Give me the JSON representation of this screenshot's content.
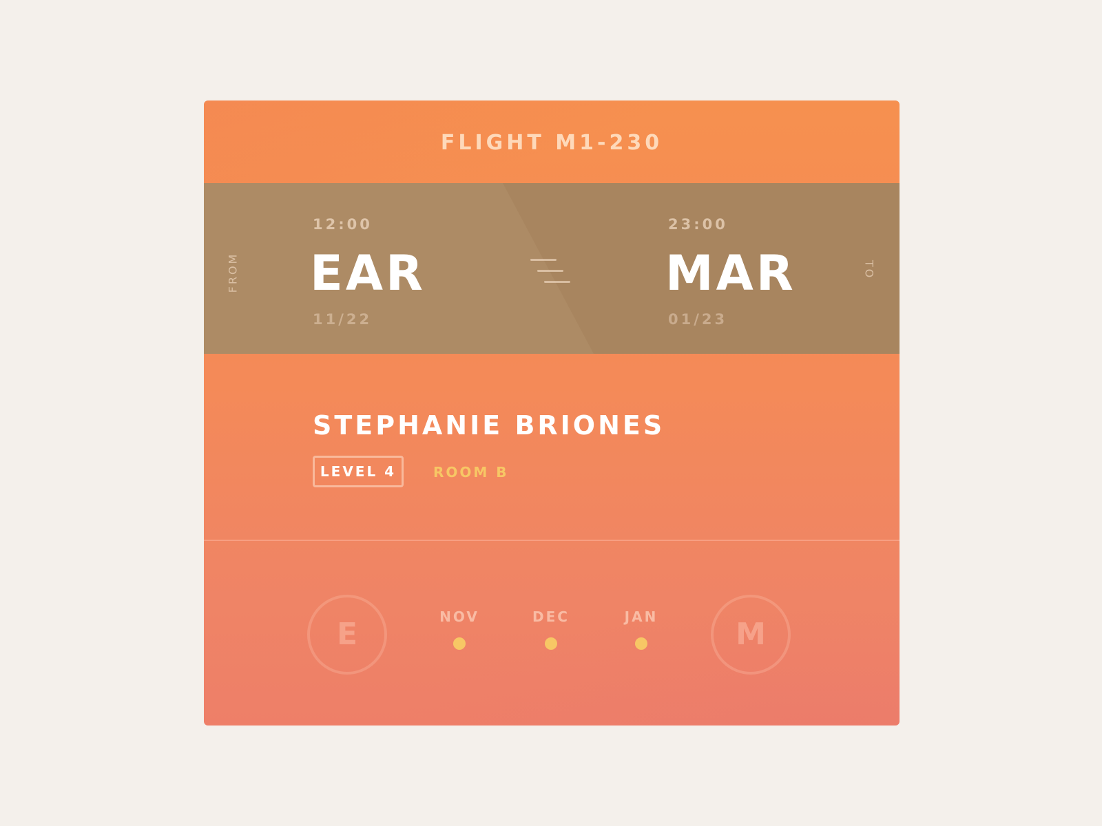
{
  "flight": {
    "title": "FLIGHT M1-230"
  },
  "route": {
    "from_label": "FROM",
    "to_label": "TO",
    "origin": {
      "time": "12:00",
      "code": "EAR",
      "date": "11/22"
    },
    "destination": {
      "time": "23:00",
      "code": "MAR",
      "date": "01/23"
    },
    "connector_icon": "flight-lines-icon"
  },
  "passenger": {
    "name": "STEPHANIE BRIONES",
    "level": "LEVEL 4",
    "room": "ROOM B"
  },
  "timeline": {
    "origin_initial": "E",
    "destination_initial": "M",
    "months": [
      "NOV",
      "DEC",
      "JAN"
    ]
  },
  "colors": {
    "background": "#f4f0eb",
    "card_top": "#f6904f",
    "card_bottom": "#ee7f68",
    "route_band": "#ad8b65",
    "accent_yellow": "#f7c765",
    "text_white": "#ffffff"
  }
}
